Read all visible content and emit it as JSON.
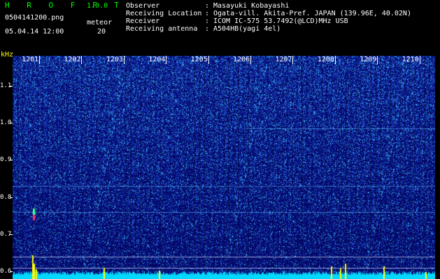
{
  "header": {
    "app_title": "H R O F F T",
    "version": "1.0.0",
    "file_name": "0504141200.png",
    "timestamp": "05.04.14 12:00",
    "meteor_label": "meteor",
    "meteor_count": "20"
  },
  "info": [
    {
      "key": "Observer",
      "value": "Masayuki Kobayashi"
    },
    {
      "key": "Receiving Location",
      "value": "Ogata-vill. Akita-Pref. JAPAN (139.96E, 40.02N)"
    },
    {
      "key": "Receiver",
      "value": "ICOM IC-575 53.7492(@LCD)MHz USB"
    },
    {
      "key": "Receiving antenna",
      "value": "A504HB(yagi 4el)"
    }
  ],
  "info_separator": ":",
  "spectrogram": {
    "unit": "kHz",
    "y_ticks": [
      {
        "label": "1.1",
        "khz": 1.1
      },
      {
        "label": "1.0",
        "khz": 1.0
      },
      {
        "label": "0.9",
        "khz": 0.9
      },
      {
        "label": "0.8",
        "khz": 0.8
      },
      {
        "label": "0.7",
        "khz": 0.7
      },
      {
        "label": "0.6",
        "khz": 0.6
      }
    ],
    "y_range_khz": [
      0.58,
      1.18
    ],
    "x_ticks": [
      "1201",
      "1202",
      "1203",
      "1204",
      "1205",
      "1206",
      "1207",
      "1208",
      "1209",
      "1210"
    ],
    "x_range_minutes": [
      0,
      10
    ],
    "horizontal_traces_khz": [
      0.985,
      0.83,
      0.76,
      0.64,
      0.61
    ],
    "meteor_pings": [
      {
        "minute": 0.48,
        "khz": 0.745,
        "color": "#ff3070"
      },
      {
        "minute": 0.48,
        "khz": 0.76,
        "color": "#40ff80"
      }
    ],
    "colors": {
      "background": "#04086a",
      "noise_dim": "#1a2ea8",
      "noise_bright": "#3ec8ff",
      "peak": "#ffff00",
      "baseline": "#00d8ff"
    }
  }
}
